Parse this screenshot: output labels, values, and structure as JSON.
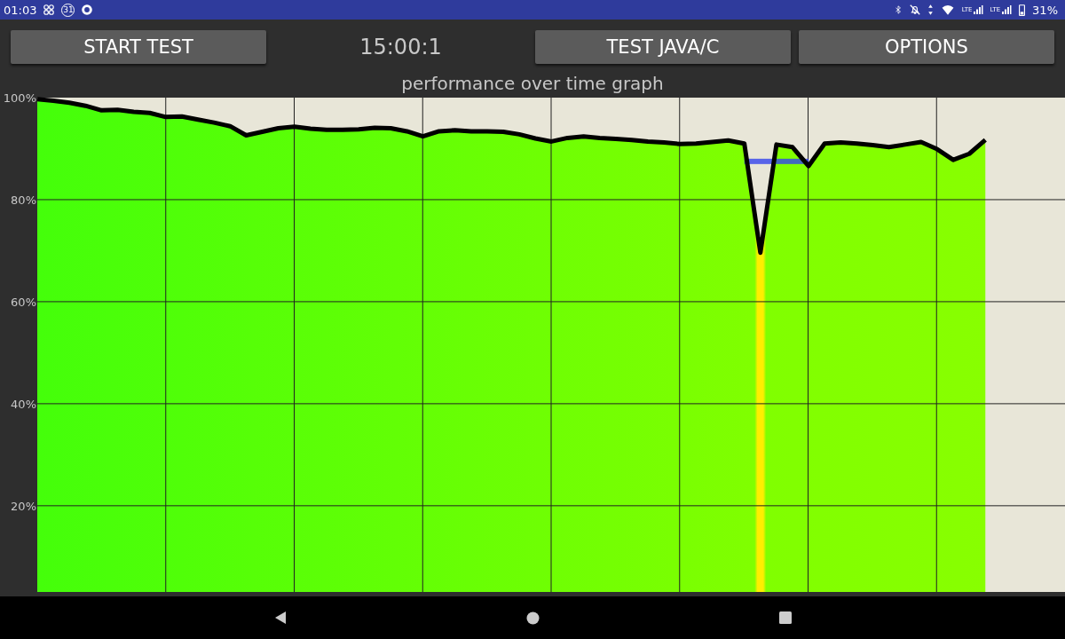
{
  "status_bar": {
    "time": "01:03",
    "calendar_badge": "31",
    "network_labels": [
      "LTE",
      "LTE"
    ],
    "battery": "31%"
  },
  "buttons": [
    {
      "label": "START TEST"
    },
    {
      "label": "TEST JAVA/C"
    },
    {
      "label": "OPTIONS"
    }
  ],
  "timer": "15:00:1",
  "graph": {
    "title": "performance over time graph",
    "chart_data": {
      "type": "line",
      "grid": true,
      "ylim": [
        3.1,
        100
      ],
      "yticks": [
        {
          "value": 100,
          "label": "100%"
        },
        {
          "value": 80,
          "label": "80%"
        },
        {
          "value": 60,
          "label": "60%"
        },
        {
          "value": 40,
          "label": "40%"
        },
        {
          "value": 20,
          "label": "20%"
        }
      ],
      "categories": [
        null,
        null,
        null,
        null,
        null,
        null,
        null,
        null,
        null,
        null,
        null,
        null,
        null,
        null,
        null,
        null,
        null,
        null,
        null,
        null,
        null,
        null,
        null,
        null,
        null,
        null,
        null,
        null,
        null,
        null,
        null,
        null,
        null,
        null,
        null,
        null,
        null,
        null,
        null,
        null,
        null,
        null,
        null,
        null,
        null,
        null,
        null,
        null,
        null,
        null,
        null,
        null,
        null,
        null,
        null,
        null,
        null,
        null,
        null,
        null
      ],
      "series": [
        {
          "color": "#000000",
          "values": [
            99.7,
            99.4,
            99.0,
            98.4,
            97.5,
            97.6,
            97.2,
            97.0,
            96.2,
            96.3,
            95.7,
            95.1,
            94.4,
            92.6,
            93.3,
            94.0,
            94.3,
            93.9,
            93.7,
            93.7,
            93.8,
            94.1,
            94.0,
            93.4,
            92.4,
            93.4,
            93.6,
            93.4,
            93.4,
            93.3,
            92.8,
            92.0,
            91.4,
            92.1,
            92.4,
            92.1,
            91.9,
            91.7,
            91.4,
            91.2,
            90.9,
            91.0,
            91.3,
            91.6,
            91.0,
            69.6,
            90.8,
            90.3,
            86.6,
            91.0,
            91.2,
            91.0,
            90.7,
            90.3,
            90.8,
            91.3,
            89.9,
            87.8,
            89.0,
            91.7
          ]
        }
      ]
    }
  }
}
